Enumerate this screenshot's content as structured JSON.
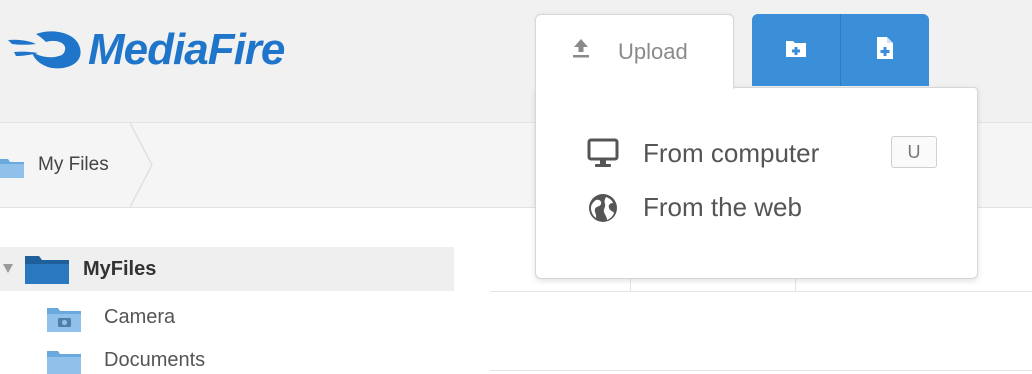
{
  "app": {
    "logo_text": "MediaFire",
    "brand_color": "#1f75c9",
    "accent_blue": "#3b8fd9"
  },
  "header": {
    "upload_tab": {
      "label": "Upload",
      "icon": "upload-icon"
    },
    "new_folder_button": {
      "icon": "new-folder-icon"
    },
    "new_file_button": {
      "icon": "new-file-icon"
    }
  },
  "upload_menu": {
    "items": [
      {
        "label": "From computer",
        "icon": "monitor-icon",
        "shortcut": "U"
      },
      {
        "label": "From the web",
        "icon": "globe-icon"
      }
    ]
  },
  "breadcrumb": {
    "items": [
      {
        "label": "My Files",
        "icon": "folder-icon"
      }
    ]
  },
  "tree": {
    "root": {
      "label": "MyFiles",
      "icon": "folder-open-icon",
      "expanded": true
    },
    "children": [
      {
        "label": "Camera",
        "icon": "camera-folder-icon"
      },
      {
        "label": "Documents",
        "icon": "folder-icon"
      }
    ]
  }
}
